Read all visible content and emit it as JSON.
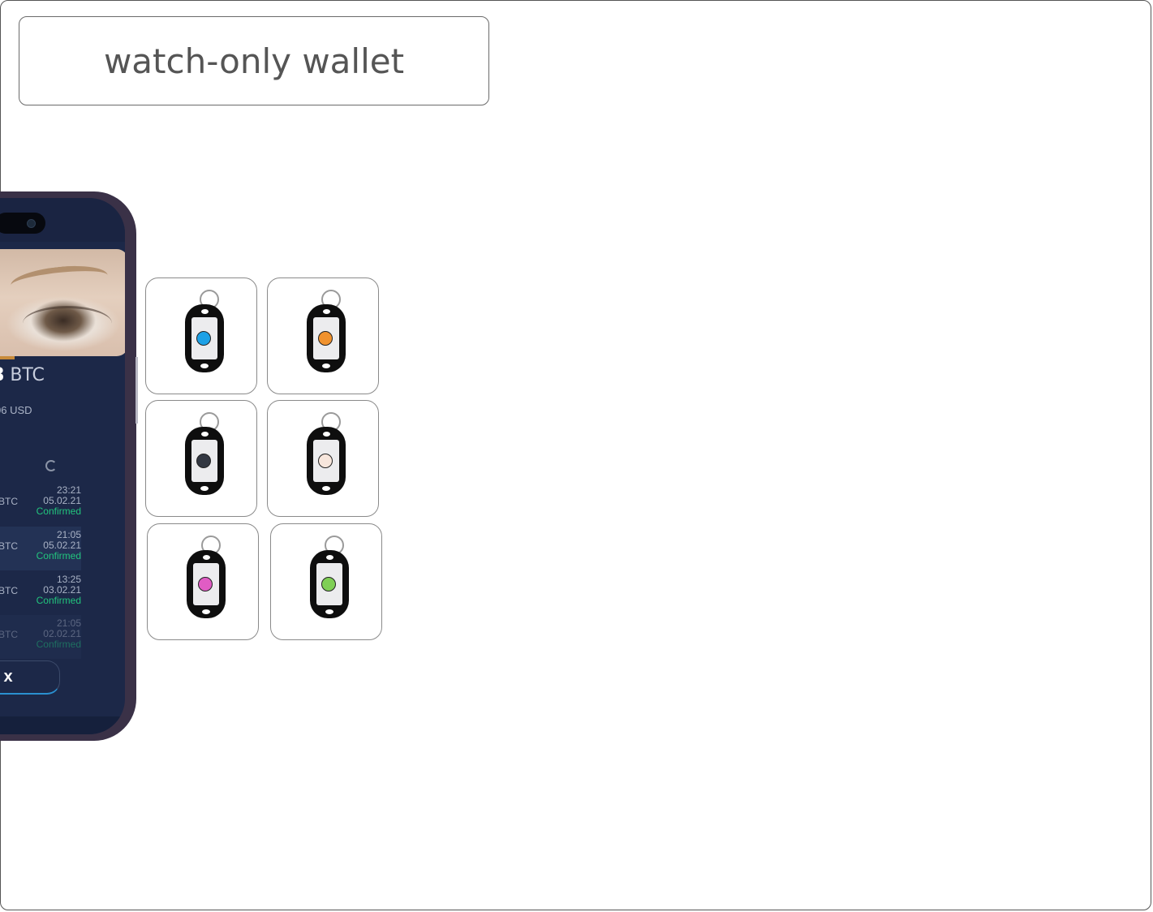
{
  "header": {
    "title": "watch-only wallet"
  },
  "phone": {
    "balance_value": "8",
    "balance_unit": "BTC",
    "usd_value": "06 USD",
    "close_label": "x",
    "transactions": [
      {
        "coin": "BTC",
        "time": "23:21",
        "date": "05.02.21",
        "status": "Confirmed"
      },
      {
        "coin": "BTC",
        "time": "21:05",
        "date": "05.02.21",
        "status": "Confirmed"
      },
      {
        "coin": "BTC",
        "time": "13:25",
        "date": "03.02.21",
        "status": "Confirmed"
      },
      {
        "coin": "BTC",
        "time": "21:05",
        "date": "02.02.21",
        "status": "Confirmed"
      }
    ]
  },
  "tags": [
    {
      "color": "#1da1e6"
    },
    {
      "color": "#f0922e"
    },
    {
      "color": "#333842"
    },
    {
      "color": "#f7e6dc"
    },
    {
      "color": "#e05cc4"
    },
    {
      "color": "#7fcf55"
    }
  ],
  "colors": {
    "confirmed": "#22c47d",
    "accent": "#2a90d0"
  }
}
